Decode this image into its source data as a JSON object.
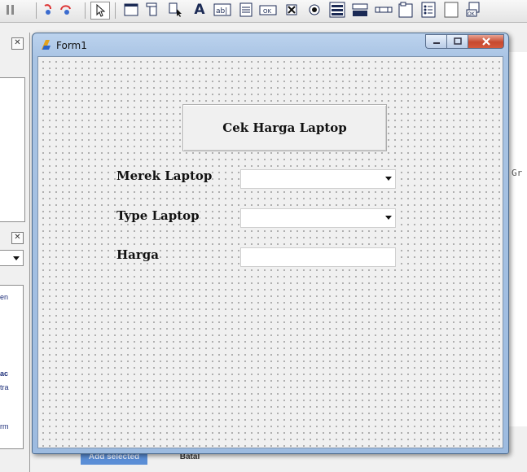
{
  "window": {
    "title": "Form1"
  },
  "form": {
    "cek_button_label": "Cek Harga Laptop",
    "merek_label": "Merek Laptop",
    "merek_value": "",
    "type_label": "Type Laptop",
    "type_value": "",
    "harga_label": "Harga",
    "harga_value": ""
  },
  "background": {
    "right_text": "Gr",
    "bottom_add_label": "Add selected",
    "bottom_batal_label": "Batal",
    "side_labels": [
      "en",
      "ac",
      "tra",
      "rm"
    ]
  },
  "toolbar": {
    "icons": [
      "pause-icon",
      "step-into-icon",
      "step-over-icon",
      "pointer-icon",
      "frame-icon",
      "main-menu-icon",
      "popup-menu-icon",
      "label-icon",
      "edit-icon",
      "memo-icon",
      "button-icon",
      "checkbox-icon",
      "radiobutton-icon",
      "listbox-icon",
      "combobox-icon",
      "scrollbar-icon",
      "groupbox-icon",
      "radiogroup-icon",
      "panel-icon",
      "actionlist-icon"
    ]
  },
  "colors": {
    "close_button": "#c7492f",
    "window_frame": "#a9c4e4"
  }
}
